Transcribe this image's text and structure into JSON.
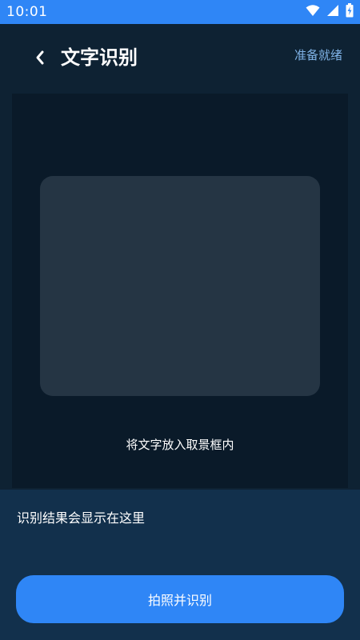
{
  "status_bar": {
    "time": "10:01",
    "icons": [
      "wifi-icon",
      "signal-icon",
      "battery-charging-icon"
    ]
  },
  "header": {
    "back_icon": "chevron-left-icon",
    "title": "文字识别",
    "status": "准备就绪"
  },
  "camera": {
    "hint": "将文字放入取景框内"
  },
  "result": {
    "placeholder": "识别结果会显示在这里"
  },
  "actions": {
    "capture_label": "拍照并识别"
  },
  "colors": {
    "accent": "#2f86f6",
    "background": "#0e2233",
    "camera_bg": "#0a1a29",
    "viewfinder": "#253544",
    "result_panel": "#12304c",
    "status_text": "#7fb2e6"
  }
}
